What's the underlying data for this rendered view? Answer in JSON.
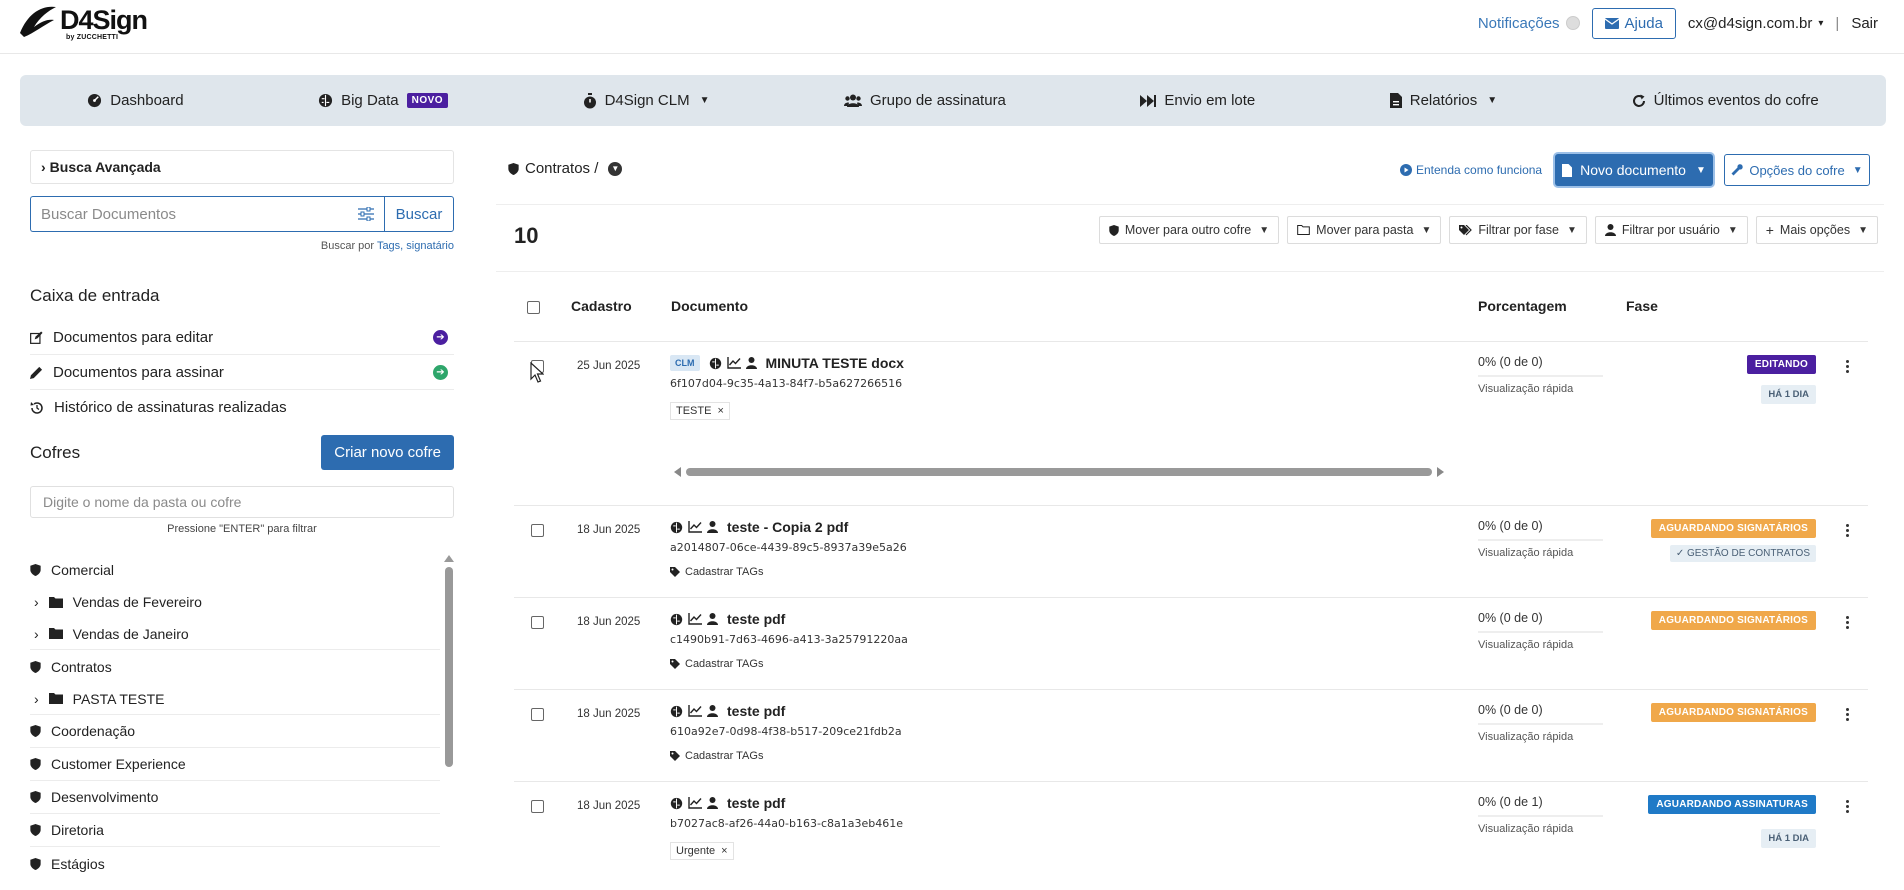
{
  "brand": {
    "name": "D4Sign",
    "sub": "by ZUCCHETTI"
  },
  "header": {
    "notifications": "Notificações",
    "help": "Ajuda",
    "user": "cx@d4sign.com.br",
    "separator": "|",
    "logout": "Sair"
  },
  "nav": {
    "dashboard": "Dashboard",
    "bigdata": "Big Data",
    "bigdata_badge": "NOVO",
    "clm": "D4Sign CLM",
    "group": "Grupo de assinatura",
    "batch": "Envio em lote",
    "reports": "Relatórios",
    "events": "Últimos eventos do cofre"
  },
  "sidebar": {
    "advanced_search": "Busca Avançada",
    "search_placeholder": "Buscar Documentos",
    "search_button": "Buscar",
    "search_hint_prefix": "Buscar por",
    "search_hint_tags": "Tags,",
    "search_hint_signer": "signatário",
    "inbox_title": "Caixa de entrada",
    "inbox": [
      "Documentos para editar",
      "Documentos para assinar",
      "Histórico de assinaturas realizadas"
    ],
    "vaults_title": "Cofres",
    "new_vault": "Criar novo cofre",
    "vault_filter_placeholder": "Digite o nome da pasta ou cofre",
    "vault_filter_hint": "Pressione \"ENTER\" para filtrar",
    "tree": {
      "comercial": "Comercial",
      "vendas_fev": "Vendas de Fevereiro",
      "vendas_jan": "Vendas de Janeiro",
      "contratos": "Contratos",
      "pasta_teste": "PASTA TESTE",
      "coordenacao": "Coordenação",
      "cx": "Customer Experience",
      "dev": "Desenvolvimento",
      "diretoria": "Diretoria",
      "estagios": "Estágios"
    }
  },
  "main": {
    "breadcrumb": "Contratos /",
    "understand": "Entenda como funciona",
    "new_document": "Novo documento",
    "vault_options": "Opções do cofre",
    "count": "10",
    "tools": {
      "move_vault": "Mover para outro cofre",
      "move_folder": "Mover para pasta",
      "filter_phase": "Filtrar por fase",
      "filter_user": "Filtrar por usuário",
      "more": "Mais opções"
    },
    "columns": {
      "date": "Cadastro",
      "document": "Documento",
      "percent": "Porcentagem",
      "phase": "Fase"
    },
    "quick_view": "Visualização rápida",
    "add_tags": "Cadastrar TAGs",
    "rows": [
      {
        "date": "25 Jun 2025",
        "clm": "CLM",
        "title": "MINUTA TESTE docx",
        "id": "6f107d04-9c35-4a13-84f7-b5a627266516",
        "tag": "TESTE",
        "percent": "0% (0 de 0)",
        "status": "EDITANDO",
        "age": "HÁ 1 DIA"
      },
      {
        "date": "18 Jun 2025",
        "title": "teste - Copia 2 pdf",
        "id": "a2014807-06ce-4439-89c5-8937a39e5a26",
        "percent": "0% (0 de 0)",
        "status": "AGUARDANDO SIGNATÁRIOS",
        "mgmt": "GESTÃO DE CONTRATOS"
      },
      {
        "date": "18 Jun 2025",
        "title": "teste pdf",
        "id": "c1490b91-7d63-4696-a413-3a25791220aa",
        "percent": "0% (0 de 0)",
        "status": "AGUARDANDO SIGNATÁRIOS"
      },
      {
        "date": "18 Jun 2025",
        "title": "teste pdf",
        "id": "610a92e7-0d98-4f38-b517-209ce21fdb2a",
        "percent": "0% (0 de 0)",
        "status": "AGUARDANDO SIGNATÁRIOS"
      },
      {
        "date": "18 Jun 2025",
        "title": "teste pdf",
        "id": "b7027ac8-af26-44a0-b163-c8a1a3eb461e",
        "tag": "Urgente",
        "percent": "0% (0 de 1)",
        "status": "AGUARDANDO ASSINATURAS",
        "age": "HÁ 1 DIA"
      }
    ]
  },
  "colors": {
    "primary": "#2d6cb0",
    "editing": "#4b1fa0",
    "awaiting_signers": "#f0a84a",
    "awaiting_signatures": "#1f7ac7",
    "nav_bg": "#dfe6ec"
  }
}
